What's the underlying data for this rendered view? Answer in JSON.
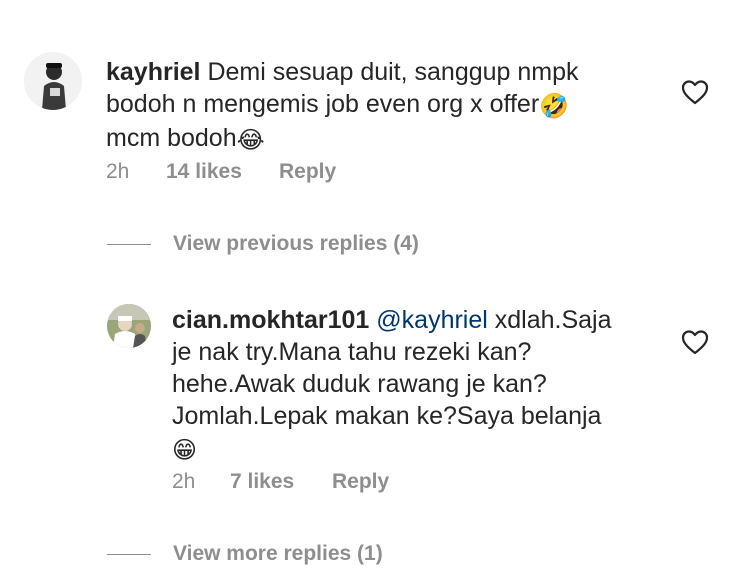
{
  "comments": [
    {
      "username": "kayhriel",
      "mention": "",
      "text_parts": [
        "Demi sesuap duit, sanggup nmpk",
        "bodoh n mengemis job even org x offer",
        "mcm bodoh"
      ],
      "emoji1": "🤣",
      "emoji2": "😂",
      "time": "2h",
      "likes": "14 likes",
      "reply": "Reply",
      "heart_icon": "heart-outline-icon"
    },
    {
      "username": "cian.mokhtar101",
      "mention": "@kayhriel",
      "text_parts": [
        "xdlah.Saja",
        "je nak try.Mana tahu rezeki kan?",
        "hehe.Awak duduk rawang je kan?",
        "Jomlah.Lepak makan ke?Saya belanja"
      ],
      "emoji1": "😁",
      "time": "2h",
      "likes": "7 likes",
      "reply": "Reply",
      "heart_icon": "heart-outline-icon"
    }
  ],
  "view_previous_replies": "View previous replies (4)",
  "view_more_replies": "View more replies (1)"
}
